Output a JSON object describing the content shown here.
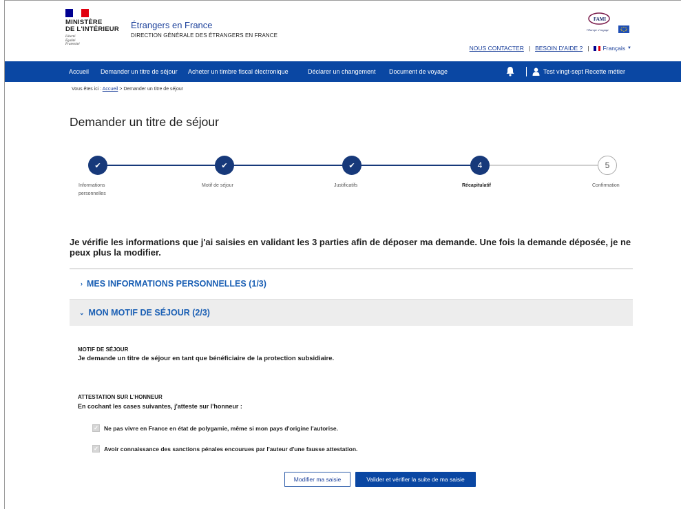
{
  "header": {
    "ministry_line1": "MINISTÈRE",
    "ministry_line2": "DE L'INTÉRIEUR",
    "motto": [
      "Liberté",
      "Égalité",
      "Fraternité"
    ],
    "site_title": "Étrangers en France",
    "site_subtitle": "DIRECTION GÉNÉRALE DES ÉTRANGERS EN FRANCE",
    "fami_logo_text": "FAMI",
    "fami_tagline": "l'Europe s'engage",
    "contact_link": "NOUS CONTACTER",
    "help_link": "BESOIN D'AIDE ?",
    "separator": "|",
    "language": "Français"
  },
  "nav": {
    "items": [
      "Accueil",
      "Demander un titre de séjour",
      "Acheter un timbre fiscal électronique",
      "Déclarer un changement",
      "Document de voyage"
    ],
    "user_name": "Test vingt-sept Recette métier"
  },
  "breadcrumb": {
    "prefix": "Vous êtes ici :",
    "home": "Accueil",
    "current": "> Demander un titre de séjour"
  },
  "page_title": "Demander un titre de séjour",
  "stepper": {
    "steps": [
      {
        "label_line1": "Informations",
        "label_line2": "personnelles",
        "state": "done",
        "marker": "✔"
      },
      {
        "label_line1": "Motif de séjour",
        "label_line2": "",
        "state": "done",
        "marker": "✔"
      },
      {
        "label_line1": "Justificatifs",
        "label_line2": "",
        "state": "done",
        "marker": "✔"
      },
      {
        "label_line1": "Récapitulatif",
        "label_line2": "",
        "state": "current",
        "marker": "4"
      },
      {
        "label_line1": "Confirmation",
        "label_line2": "",
        "state": "todo",
        "marker": "5"
      }
    ]
  },
  "intro_text": "Je vérifie les informations que j'ai saisies en validant les 3 parties afin de déposer ma demande. Une fois la demande déposée, je ne peux plus la modifier.",
  "accordion": {
    "section1": "MES INFORMATIONS PERSONNELLES (1/3)",
    "section2": "MON MOTIF DE SÉJOUR (2/3)"
  },
  "motif": {
    "label": "MOTIF DE SÉJOUR",
    "text": "Je demande un titre de séjour en tant que bénéficiaire de la protection subsidiaire."
  },
  "attestation": {
    "label": "ATTESTATION SUR L'HONNEUR",
    "intro": "En cochant les cases suivantes, j'atteste sur l'honneur :",
    "items": [
      "Ne pas vivre en France en état de polygamie, même si mon pays d'origine l'autorise.",
      "Avoir connaissance des sanctions pénales encourues par l'auteur d'une fausse attestation."
    ]
  },
  "buttons": {
    "modify": "Modifier ma saisie",
    "validate": "Valider et vérifier la suite de ma saisie"
  },
  "colors": {
    "nav_blue": "#0a47a3",
    "step_blue": "#17397a",
    "link_blue": "#1a5fb4"
  }
}
